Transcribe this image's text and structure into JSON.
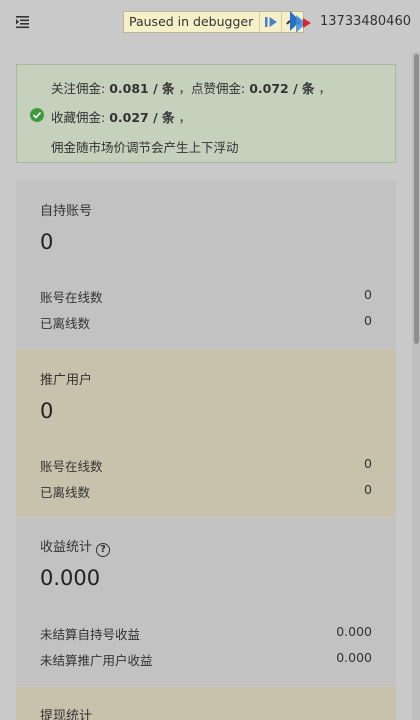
{
  "header": {
    "debugger_label": "Paused in debugger",
    "phone": "13733480460"
  },
  "notice": {
    "follow_label": "关注佣金:",
    "follow_value": "0.081 / 条",
    "like_label": "，点赞佣金:",
    "like_value": "0.072 / 条",
    "sep": "，",
    "collect_label": "收藏佣金:",
    "collect_value": "0.027 / 条",
    "sep2": "，",
    "note": "佣金随市场价调节会产生上下浮动"
  },
  "cards": [
    {
      "title": "自持账号",
      "value": "0",
      "rows": [
        {
          "label": "账号在线数",
          "value": "0"
        },
        {
          "label": "已离线数",
          "value": "0"
        }
      ]
    },
    {
      "title": "推广用户",
      "value": "0",
      "rows": [
        {
          "label": "账号在线数",
          "value": "0"
        },
        {
          "label": "已离线数",
          "value": "0"
        }
      ]
    },
    {
      "title": "收益统计",
      "help_icon": "?",
      "value": "0.000",
      "rows": [
        {
          "label": "未结算自持号收益",
          "value": "0.000"
        },
        {
          "label": "未结算推广用户收益",
          "value": "0.000"
        }
      ]
    },
    {
      "title": "提现统计"
    }
  ],
  "colors": {
    "accent_green": "#3f9a3b",
    "debugger_bg": "#f5f0c8"
  }
}
